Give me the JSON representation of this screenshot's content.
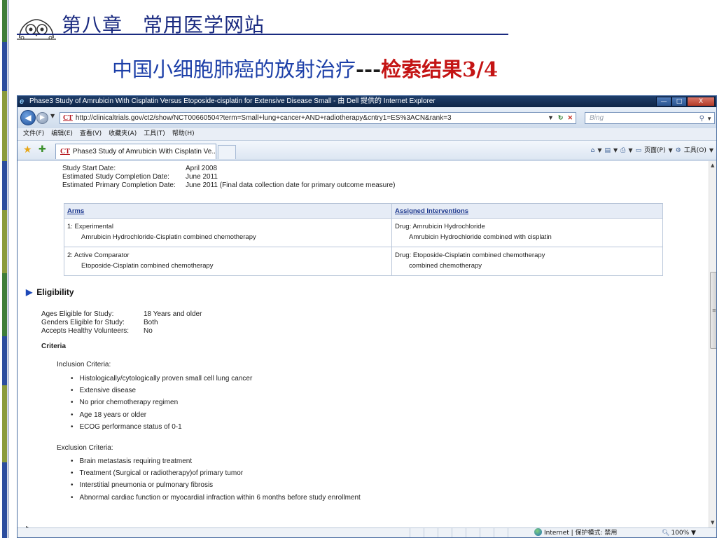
{
  "slide": {
    "chapter_title": "第八章　常用医学网站",
    "subtitle_main": "中国小细胞肺癌的放射治疗",
    "subtitle_dashes": "---",
    "subtitle_result": "检索结果3/4"
  },
  "window": {
    "title": "Phase3 Study of Amrubicin With Cisplatin Versus Etoposide-cisplatin for Extensive Disease Small - 由 Dell 提供的 Internet Explorer",
    "min_glyph": "—",
    "max_glyph": "□",
    "close_glyph": "X"
  },
  "address": {
    "ct_logo": "CT",
    "url": "http://clinicaltrials.gov/ct2/show/NCT00660504?term=Small+lung+cancer+AND+radiotherapy&cntry1=ES%3ACN&rank=3",
    "search_placeholder": "Bing"
  },
  "menu": [
    "文件(F)",
    "编辑(E)",
    "查看(V)",
    "收藏夹(A)",
    "工具(T)",
    "帮助(H)"
  ],
  "tab": {
    "ct_logo": "CT",
    "label": "Phase3 Study of Amrubicin With Cisplatin Ve..."
  },
  "commands": {
    "page": "页面(P)",
    "tools": "工具(O)"
  },
  "study_dates": [
    {
      "label": "Study Start Date:",
      "value": "April 2008"
    },
    {
      "label": "Estimated Study Completion Date:",
      "value": "June 2011"
    },
    {
      "label": "Estimated Primary Completion Date:",
      "value": "June 2011 (Final data collection date for primary outcome measure)"
    }
  ],
  "arms_table": {
    "headers": [
      "Arms",
      "Assigned Interventions"
    ],
    "rows": [
      {
        "arm": "1: Experimental",
        "arm_detail": "Amrubicin Hydrochloride-Cisplatin combined chemotherapy",
        "intervention": "Drug: Amrubicin Hydrochloride",
        "intervention_detail": "Amrubicin Hydrochloride combined with cisplatin"
      },
      {
        "arm": "2: Active Comparator",
        "arm_detail": "Etoposide-Cisplatin combined chemotherapy",
        "intervention": "Drug: Etoposide-Cisplatin combined chemotherapy",
        "intervention_detail": "combined chemotherapy"
      }
    ]
  },
  "eligibility": {
    "heading": "Eligibility",
    "rows": [
      {
        "label": "Ages Eligible for Study:",
        "value": "18 Years and older"
      },
      {
        "label": "Genders Eligible for Study:",
        "value": "Both"
      },
      {
        "label": "Accepts Healthy Volunteers:",
        "value": "No"
      }
    ],
    "criteria_label": "Criteria",
    "inclusion_label": "Inclusion Criteria:",
    "inclusion": [
      "Histologically/cytologically proven small cell lung cancer",
      "Extensive disease",
      "No prior chemotherapy regimen",
      "Age 18 years or older",
      "ECOG performance status of 0-1"
    ],
    "exclusion_label": "Exclusion Criteria:",
    "exclusion": [
      "Brain metastasis requiring treatment",
      "Treatment (Surgical or radiotherapy)of primary tumor",
      "Interstitial pneumonia or pulmonary fibrosis",
      "Abnormal cardiac function or myocardial infraction within 6 months before study enrollment"
    ]
  },
  "status": {
    "zone": "Internet | 保护模式: 禁用",
    "zoom": "100%"
  },
  "colors": {
    "chapter_blue": "#1a2a80",
    "subtitle_blue": "#1c3fa8",
    "subtitle_red": "#c41414",
    "link_blue": "#1f3a8f"
  }
}
